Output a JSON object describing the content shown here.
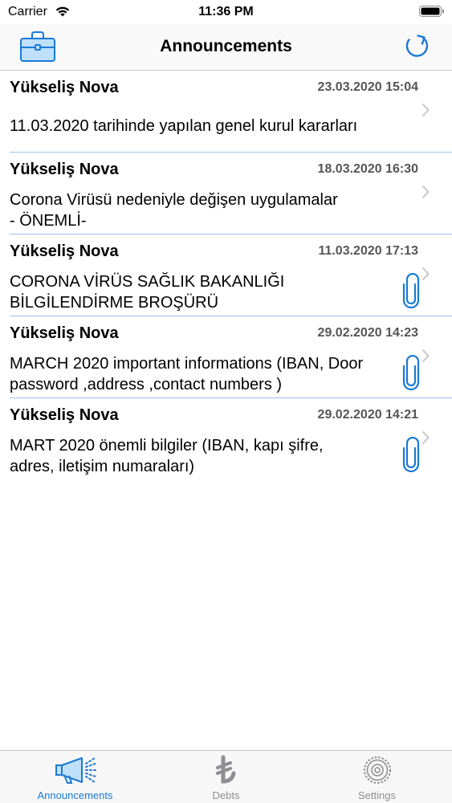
{
  "status": {
    "carrier": "Carrier",
    "time": "11:36 PM"
  },
  "nav": {
    "title": "Announcements",
    "left_icon": "briefcase-icon",
    "right_icon": "refresh-icon"
  },
  "announcements": [
    {
      "sender": "Yükseliş Nova",
      "date": "23.03.2020 15:04",
      "text": "11.03.2020 tarihinde yapılan genel kurul kararları",
      "attachment": false
    },
    {
      "sender": "Yükseliş Nova",
      "date": "18.03.2020 16:30",
      "text": "Corona Virüsü nedeniyle değişen uygulamalar\n- ÖNEMLİ-",
      "attachment": false
    },
    {
      "sender": "Yükseliş Nova",
      "date": "11.03.2020 17:13",
      "text": "CORONA VİRÜS SAĞLIK BAKANLIĞI\nBİLGİLENDİRME BROŞÜRÜ",
      "attachment": true
    },
    {
      "sender": "Yükseliş Nova",
      "date": "29.02.2020 14:23",
      "text": "MARCH 2020 important informations (IBAN, Door\npassword ,address ,contact numbers )",
      "attachment": true
    },
    {
      "sender": "Yükseliş Nova",
      "date": "29.02.2020 14:21",
      "text": "MART 2020 önemli bilgiler (IBAN, kapı şifre,\nadres, iletişim numaraları)",
      "attachment": true
    }
  ],
  "tabs": [
    {
      "label": "Announcements",
      "icon": "megaphone-icon",
      "active": true
    },
    {
      "label": "Debts",
      "icon": "lira-icon",
      "active": false
    },
    {
      "label": "Settings",
      "icon": "gear-icon",
      "active": false
    }
  ],
  "colors": {
    "accent": "#1a7ad6",
    "inactive": "#8e8e93",
    "divider": "#9ec3e6"
  }
}
